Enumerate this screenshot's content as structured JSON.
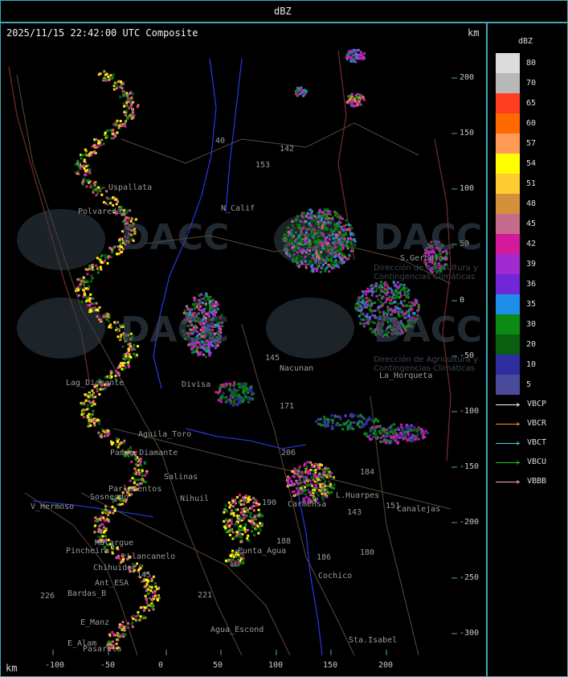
{
  "header": {
    "title": "dBZ"
  },
  "map": {
    "timestamp": "2025/11/15 22:42:00 UTC Composite",
    "unit_top": "km",
    "unit_bottom": "km",
    "x_ticks": [
      "-100",
      "-50",
      "0",
      "50",
      "100",
      "150",
      "200"
    ],
    "y_ticks": [
      "200",
      "150",
      "100",
      "50",
      "0",
      "-50",
      "-100",
      "-150",
      "-200",
      "-250",
      "-300"
    ],
    "watermark": "DACC",
    "watermark_sub": "Dirección de Agricultura y Contingencias Climáticas",
    "places": [
      {
        "name": "Uspallata"
      },
      {
        "name": "Polvaredas"
      },
      {
        "name": "N_Calif"
      },
      {
        "name": "Lag_Diamante"
      },
      {
        "name": "Aguila_Toro"
      },
      {
        "name": "Pampa_Diamante"
      },
      {
        "name": "Parlamentos"
      },
      {
        "name": "Sosneado"
      },
      {
        "name": "V_Hermoso"
      },
      {
        "name": "Nihuil"
      },
      {
        "name": "Salinas"
      },
      {
        "name": "Punta_Agua"
      },
      {
        "name": "Llancanelo"
      },
      {
        "name": "Chihuido"
      },
      {
        "name": "Pincheira"
      },
      {
        "name": "Ant_ESA"
      },
      {
        "name": "Bardas_B"
      },
      {
        "name": "E_Manz"
      },
      {
        "name": "E_Alam"
      },
      {
        "name": "Pasarela"
      },
      {
        "name": "Agua_Escond"
      },
      {
        "name": "Nacunan"
      },
      {
        "name": "Divisa"
      },
      {
        "name": "S.Geronimo"
      },
      {
        "name": "La_Horqueta"
      },
      {
        "name": "L.Huarpes"
      },
      {
        "name": "Canalejas"
      },
      {
        "name": "Carmensa"
      },
      {
        "name": "Cochico"
      },
      {
        "name": "Sta.Isabel"
      },
      {
        "name": "Malargue"
      }
    ],
    "route_numbers": [
      "40",
      "142",
      "153",
      "145",
      "171",
      "206",
      "184",
      "190",
      "188",
      "151",
      "143",
      "186",
      "180",
      "145",
      "221",
      "226"
    ]
  },
  "legend": {
    "unit": "dBZ",
    "colors": [
      {
        "label": "80",
        "color": "#dcdcdc"
      },
      {
        "label": "70",
        "color": "#b8b8b8"
      },
      {
        "label": "65",
        "color": "#ff3d1f"
      },
      {
        "label": "60",
        "color": "#ff6a00"
      },
      {
        "label": "57",
        "color": "#ff9a55"
      },
      {
        "label": "54",
        "color": "#ffff00"
      },
      {
        "label": "51",
        "color": "#ffcc33"
      },
      {
        "label": "48",
        "color": "#d4913a"
      },
      {
        "label": "45",
        "color": "#c46a8a"
      },
      {
        "label": "42",
        "color": "#d31a9a"
      },
      {
        "label": "39",
        "color": "#a12ad1"
      },
      {
        "label": "36",
        "color": "#7126d8"
      },
      {
        "label": "35",
        "color": "#1e8fe8"
      },
      {
        "label": "30",
        "color": "#0b8a14"
      },
      {
        "label": "20",
        "color": "#0b5e10"
      },
      {
        "label": "10",
        "color": "#2e2ea0"
      },
      {
        "label": "5",
        "color": "#4a4a9a"
      }
    ],
    "radars": [
      {
        "name": "VBCP",
        "color": "#ffffff"
      },
      {
        "name": "VBCR",
        "color": "#ff9a2a"
      },
      {
        "name": "VBCT",
        "color": "#40d8e8"
      },
      {
        "name": "VBCU",
        "color": "#22cc22"
      },
      {
        "name": "VBBB",
        "color": "#ffb0c0"
      }
    ]
  }
}
